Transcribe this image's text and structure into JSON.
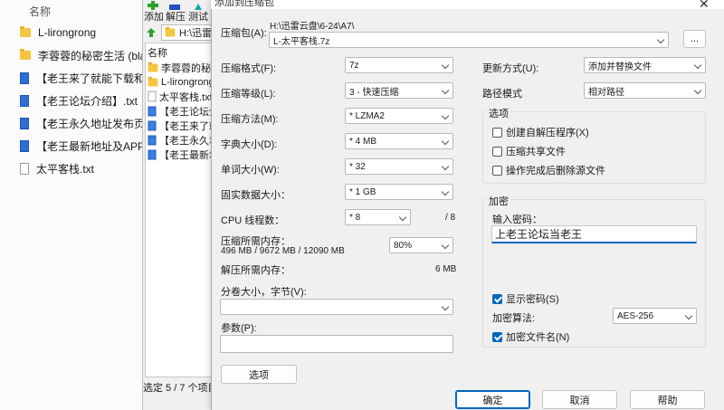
{
  "explorer": {
    "column_header": "名称",
    "items": [
      {
        "label": "L-lirongrong",
        "icon": "folder-icon"
      },
      {
        "label": "李蓉蓉的秘密生活 (blazed",
        "icon": "folder-icon"
      },
      {
        "label": "【老王来了就能下载和观看",
        "icon": "word-doc-icon"
      },
      {
        "label": "【老王论坛介绍】.txt",
        "icon": "word-doc-icon"
      },
      {
        "label": "【老王永久地址发布页】.t",
        "icon": "word-doc-icon"
      },
      {
        "label": "【老王最新地址及APP请发",
        "icon": "word-doc-icon"
      },
      {
        "label": "太平客栈.txt",
        "icon": "text-file-icon"
      }
    ]
  },
  "zip_manager": {
    "toolbar": {
      "add": "添加",
      "extract": "解压",
      "test": "测试"
    },
    "address": "H:\\迅雷",
    "list_header": "名称",
    "rows": [
      {
        "label": "李蓉蓉的秘密",
        "icon": "folder-icon"
      },
      {
        "label": "L-lirongrong",
        "icon": "folder-icon"
      },
      {
        "label": "太平客栈.txt",
        "icon": "text-file-icon"
      },
      {
        "label": "【老王论坛介",
        "icon": "word-doc-icon"
      },
      {
        "label": "【老王来了就",
        "icon": "word-doc-icon"
      },
      {
        "label": "【老王永久地",
        "icon": "word-doc-icon"
      },
      {
        "label": "【老王最新地",
        "icon": "word-doc-icon"
      }
    ],
    "status": "选定 5 / 7 个项目"
  },
  "dialog": {
    "title": "添加到压缩包",
    "archive_label": "压缩包(A):",
    "archive_path": "H:\\迅雷云盘\\6-24\\A7\\",
    "archive_name": "L-太平客栈.7z",
    "browse_label": "...",
    "format_label": "压缩格式(F):",
    "format_value": "7z",
    "level_label": "压缩等级(L):",
    "level_value": "3 - 快速压缩",
    "method_label": "压缩方法(M):",
    "method_value": "* LZMA2",
    "dict_label": "字典大小(D):",
    "dict_value": "* 4 MB",
    "word_label": "单词大小(W):",
    "word_value": "* 32",
    "solid_label": "固实数据大小：",
    "solid_value": "* 1 GB",
    "cpu_label": "CPU 线程数：",
    "cpu_value": "* 8",
    "cpu_total": "/ 8",
    "mem_compress_label": "压缩所需内存：",
    "mem_compress_value": "496 MB / 9672 MB / 12090 MB",
    "mem_percent": "80%",
    "mem_decompress_label": "解压所需内存：",
    "mem_decompress_value": "6 MB",
    "split_label": "分卷大小，字节(V):",
    "split_value": "",
    "params_label": "参数(P):",
    "params_value": "",
    "options_button": "选项",
    "update_label": "更新方式(U):",
    "update_value": "添加并替换文件",
    "path_label": "路径模式",
    "path_value": "相对路径",
    "options_group": "选项",
    "opt_sfx": "创建自解压程序(X)",
    "opt_shared": "压缩共享文件",
    "opt_delete": "操作完成后删除源文件",
    "encryption_group": "加密",
    "password_label": "输入密码：",
    "password_value": "上老王论坛当老王",
    "show_password": "显示密码(S)",
    "enc_method_label": "加密算法:",
    "enc_method_value": "AES-256",
    "encrypt_names": "加密文件名(N)",
    "ok_button": "确定",
    "cancel_button": "取消",
    "help_button": "帮助"
  }
}
